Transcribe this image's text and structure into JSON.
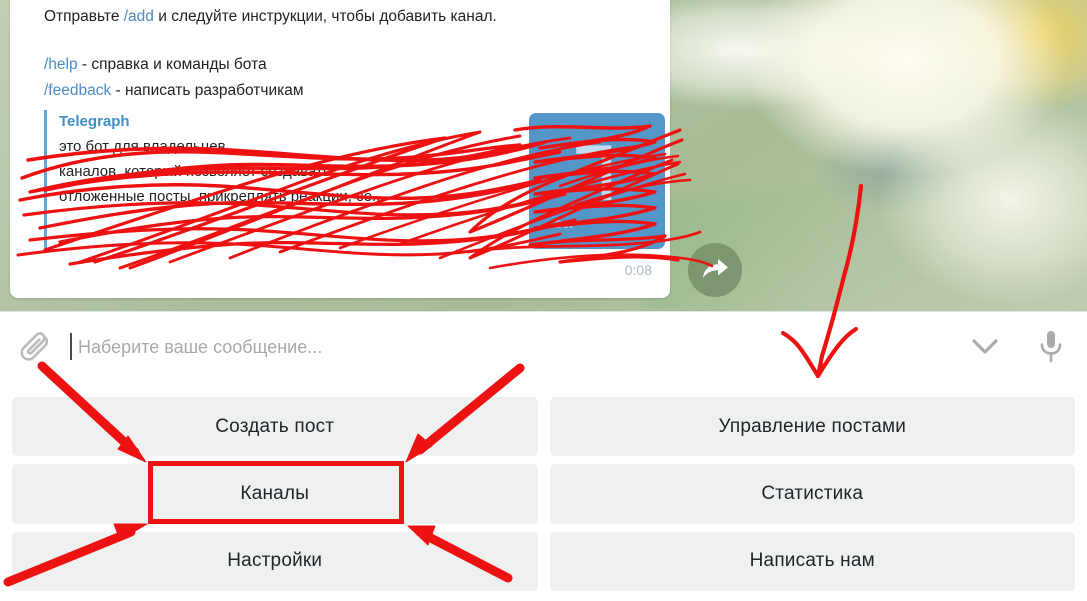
{
  "message": {
    "lines": [
      {
        "segments": [
          {
            "text": "Отправьте ",
            "type": "plain"
          },
          {
            "text": "/add",
            "type": "command"
          },
          {
            "text": " и следуйте инструкции, чтобы добавить канал.",
            "type": "plain"
          }
        ]
      },
      {
        "segments": [
          {
            "text": "/help",
            "type": "command"
          },
          {
            "text": " - справка и команды бота",
            "type": "plain"
          }
        ]
      },
      {
        "segments": [
          {
            "text": "/feedback",
            "type": "command"
          },
          {
            "text": " - написать разработчикам",
            "type": "plain"
          }
        ]
      }
    ],
    "line1_prefix": "Отправьте ",
    "line1_command": "/add",
    "line1_suffix": " и следуйте инструкции, чтобы добавить канал.",
    "line2_command": "/help",
    "line2_text": " - справка и команды бота",
    "line3_command": "/feedback",
    "line3_text": " - написать разработчикам",
    "timestamp": "0:08"
  },
  "link_preview": {
    "title": "Telegraph",
    "body_line1": "",
    "body_line2": "это бот для владельцев",
    "body_line3": "каналов, который позволяет создавать",
    "body_line4": "отложенные посты, прикреплять реакции, со...",
    "thumb_glyph": "Ꞁ",
    "thumb_brand": "Bot",
    "accent_color": "#61a8d8",
    "thumb_color": "#5596c8",
    "redacted": true
  },
  "input": {
    "placeholder": "Наберите ваше сообщение...",
    "value": "",
    "attach_icon": "paperclip-icon",
    "chevron_icon": "chevron-down-icon",
    "mic_icon": "microphone-icon"
  },
  "keyboard": {
    "buttons": [
      {
        "label": "Создать пост",
        "highlighted": false
      },
      {
        "label": "Управление постами",
        "highlighted": false
      },
      {
        "label": "Каналы",
        "highlighted": true
      },
      {
        "label": "Статистика",
        "highlighted": false
      },
      {
        "label": "Настройки",
        "highlighted": false
      },
      {
        "label": "Написать нам",
        "highlighted": false
      }
    ]
  },
  "annotations": {
    "highlight_color": "#ee1111",
    "scribble_color": "#ee1111",
    "highlight_target": "Каналы",
    "arrow_count": 5,
    "button_bg": "#eff0f0"
  },
  "forward_button": {
    "icon": "forward-arrow-icon"
  }
}
